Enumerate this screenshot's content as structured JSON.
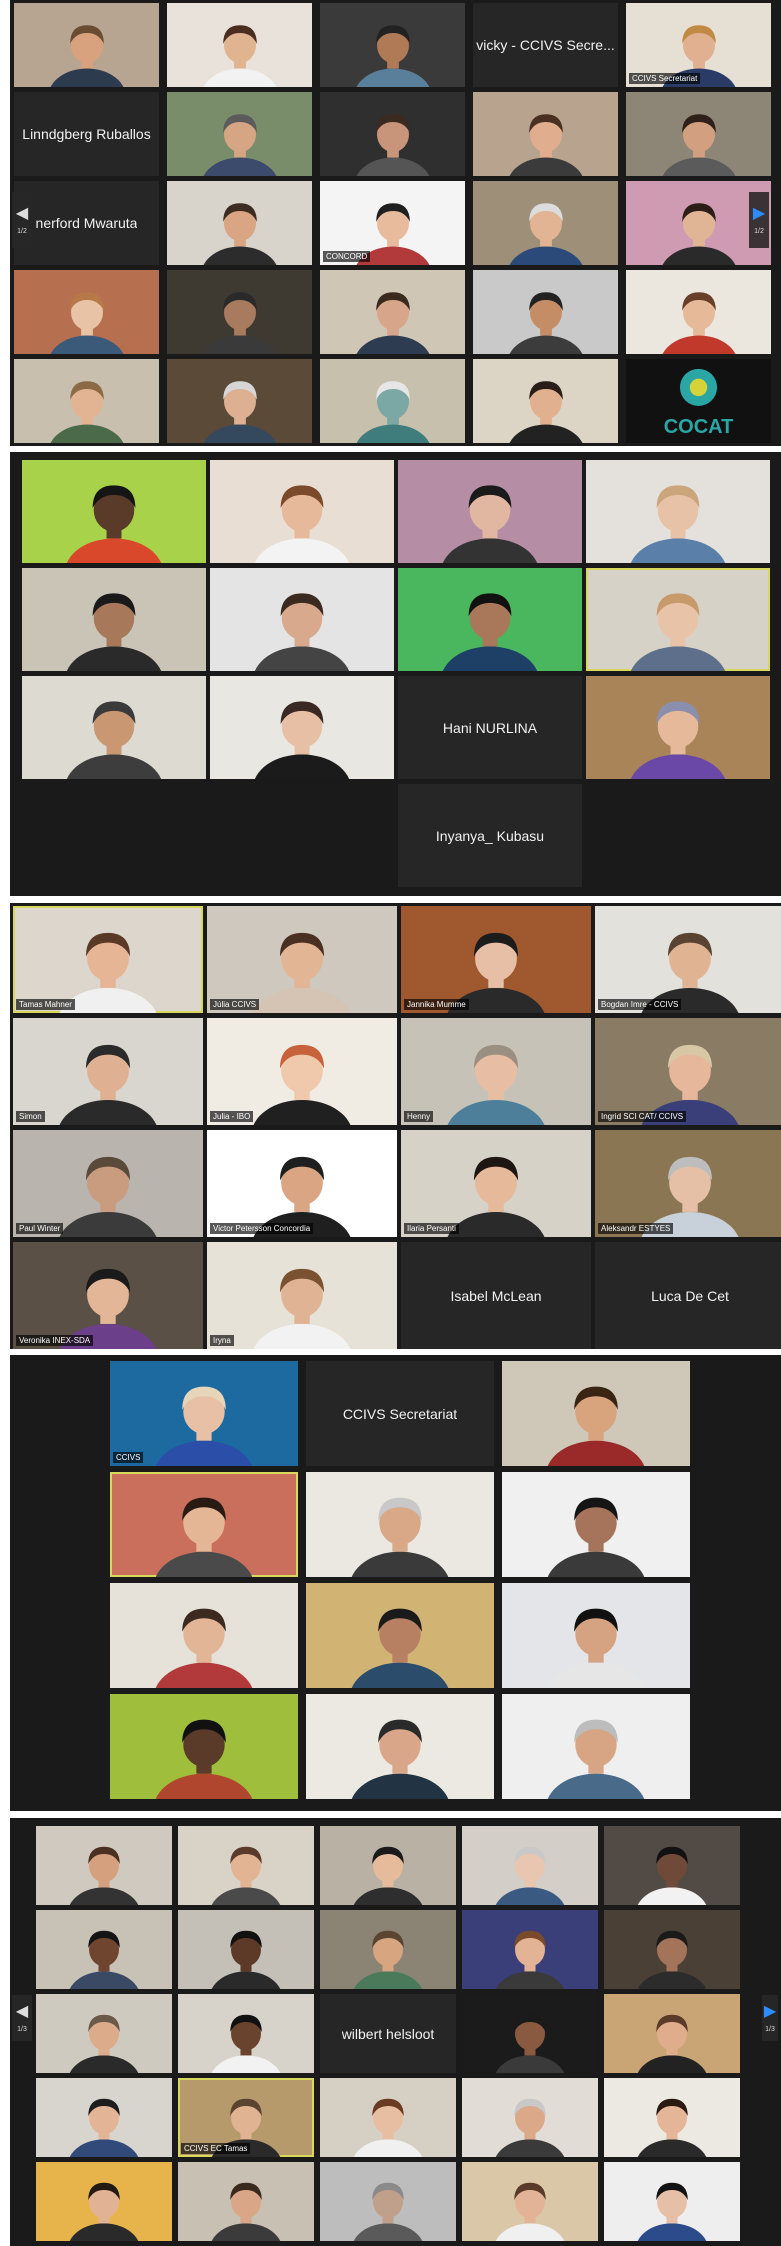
{
  "screenshot_1": {
    "tiles": [
      {
        "kind": "video",
        "bg": "#b7a592",
        "skin": "#d9a27e",
        "hair": "#6a4c33",
        "shirt": "#2d3b4e",
        "caption": ""
      },
      {
        "kind": "video",
        "bg": "#e8e2da",
        "skin": "#e0b48f",
        "hair": "#4b2e20",
        "shirt": "#f2f2f2",
        "caption": ""
      },
      {
        "kind": "video",
        "bg": "#3a3a3a",
        "skin": "#b07a57",
        "hair": "#222222",
        "shirt": "#5a7f9b",
        "caption": ""
      },
      {
        "kind": "name",
        "name": "vicky - CCIVS Secre..."
      },
      {
        "kind": "video",
        "bg": "#e6dfd3",
        "skin": "#e1b090",
        "hair": "#c08a45",
        "shirt": "#2a3c66",
        "caption": "CCIVS Secretariat"
      },
      {
        "kind": "name",
        "name": "Linndgberg Ruballos"
      },
      {
        "kind": "video",
        "bg": "#7a8d6b",
        "skin": "#d6a583",
        "hair": "#5b5b5b",
        "shirt": "#3c4a6b",
        "caption": ""
      },
      {
        "kind": "video",
        "bg": "#2f2f2f",
        "skin": "#c8957a",
        "hair": "#3a2a20",
        "shirt": "#555555",
        "caption": ""
      },
      {
        "kind": "video",
        "bg": "#b8a48e",
        "skin": "#e0ae8e",
        "hair": "#4a3020",
        "shirt": "#3b3b3b",
        "caption": ""
      },
      {
        "kind": "video",
        "bg": "#8d8575",
        "skin": "#d2a080",
        "hair": "#2f2119",
        "shirt": "#5b5b5b",
        "caption": ""
      },
      {
        "kind": "name",
        "name": "nerford Mwaruta"
      },
      {
        "kind": "video",
        "bg": "#d8d4cc",
        "skin": "#d9a583",
        "hair": "#3d2c22",
        "shirt": "#2c2c2c",
        "caption": ""
      },
      {
        "kind": "video",
        "bg": "#f4f4f4",
        "skin": "#e7bb9c",
        "hair": "#1f1f1f",
        "shirt": "#b23a3a",
        "caption": "CONCORD"
      },
      {
        "kind": "video",
        "bg": "#9d8f78",
        "skin": "#e2b493",
        "hair": "#dcdcdc",
        "shirt": "#2b4a7a",
        "caption": ""
      },
      {
        "kind": "video",
        "bg": "#cf9bb3",
        "skin": "#e0b596",
        "hair": "#2b1e18",
        "shirt": "#2a2a2a",
        "caption": ""
      },
      {
        "kind": "video",
        "bg": "#b6704f",
        "skin": "#e9c3a6",
        "hair": "#b57a48",
        "shirt": "#3b5a7a",
        "caption": ""
      },
      {
        "kind": "video",
        "bg": "#3e3a32",
        "skin": "#a87a5e",
        "hair": "#2a2a2a",
        "shirt": "#3a3a3a",
        "caption": ""
      },
      {
        "kind": "video",
        "bg": "#cfc6b6",
        "skin": "#d7a58a",
        "hair": "#3a2a1e",
        "shirt": "#2e3c52",
        "caption": ""
      },
      {
        "kind": "video",
        "bg": "#c9c9c9",
        "skin": "#c58d66",
        "hair": "#222222",
        "shirt": "#3c3c3c",
        "caption": ""
      },
      {
        "kind": "video",
        "bg": "#ebe7de",
        "skin": "#e6b998",
        "hair": "#6a3f2a",
        "shirt": "#c0392b",
        "caption": ""
      },
      {
        "kind": "video",
        "bg": "#c9bfae",
        "skin": "#e2b494",
        "hair": "#8b6a45",
        "shirt": "#4a6a4a",
        "caption": ""
      },
      {
        "kind": "video",
        "bg": "#5b4a38",
        "skin": "#dcb091",
        "hair": "#d6d6d6",
        "shirt": "#34495e",
        "caption": ""
      },
      {
        "kind": "video",
        "bg": "#c7c0ad",
        "skin": "#7ba7a4",
        "hair": "#e6e6e6",
        "shirt": "#3f7c7c",
        "caption": ""
      },
      {
        "kind": "video",
        "bg": "#dcd5c6",
        "skin": "#e0b08f",
        "hair": "#2a1c16",
        "shirt": "#222222",
        "caption": ""
      },
      {
        "kind": "logo",
        "logo_text": "COCAT",
        "bg": "#111111"
      }
    ],
    "pager": {
      "left_page": "1/2",
      "right_page": "1/2"
    }
  },
  "screenshot_2": {
    "tiles": [
      {
        "kind": "video",
        "bg": "#a8d24a",
        "skin": "#5a3a28",
        "hair": "#151515",
        "shirt": "#d9482b",
        "caption": ""
      },
      {
        "kind": "video",
        "bg": "#e8ded4",
        "skin": "#e6b99a",
        "hair": "#7b4a2a",
        "shirt": "#f3f3f3",
        "caption": ""
      },
      {
        "kind": "video",
        "bg": "#b58ea6",
        "skin": "#e2b7a2",
        "hair": "#1a1a1a",
        "shirt": "#333333",
        "caption": ""
      },
      {
        "kind": "video",
        "bg": "#e4e1dc",
        "skin": "#e7c2a6",
        "hair": "#caa67a",
        "shirt": "#5a7fa8",
        "caption": ""
      },
      {
        "kind": "video",
        "bg": "#c9c4b6",
        "skin": "#a8785b",
        "hair": "#1a1a1a",
        "shirt": "#2a2a2a",
        "caption": ""
      },
      {
        "kind": "video",
        "bg": "#e4e4e4",
        "skin": "#d8a98c",
        "hair": "#3b2a20",
        "shirt": "#444444",
        "caption": ""
      },
      {
        "kind": "video",
        "bg": "#4ab65d",
        "skin": "#a9785b",
        "hair": "#111111",
        "shirt": "#1e3f66",
        "caption": ""
      },
      {
        "kind": "video",
        "bg": "#d7d2c8",
        "skin": "#e8c3a8",
        "hair": "#c69a6a",
        "shirt": "#5d6f8a",
        "caption": ""
      },
      {
        "kind": "video",
        "bg": "#dddad2",
        "skin": "#c99772",
        "hair": "#3a3a3a",
        "shirt": "#3d3d3d",
        "caption": ""
      },
      {
        "kind": "video",
        "bg": "#e9e7e2",
        "skin": "#e7bfa4",
        "hair": "#3a2822",
        "shirt": "#1b1b1b",
        "caption": ""
      },
      {
        "kind": "name",
        "name": "Hani NURLINA"
      },
      {
        "kind": "video",
        "bg": "#a98459",
        "skin": "#e6b99b",
        "hair": "#8a8fae",
        "shirt": "#6a48a8",
        "caption": ""
      },
      {
        "kind": "empty"
      },
      {
        "kind": "empty"
      },
      {
        "kind": "name",
        "name": "Inyanya_ Kubasu"
      },
      {
        "kind": "empty"
      }
    ]
  },
  "screenshot_3": {
    "tiles": [
      {
        "kind": "video",
        "bg": "#dcd6cc",
        "skin": "#e6b596",
        "hair": "#5a3a26",
        "shirt": "#f0f0f0",
        "caption": "Tamas Mahner"
      },
      {
        "kind": "video",
        "bg": "#cfc8be",
        "skin": "#e2b594",
        "hair": "#4a3022",
        "shirt": "#d5c3b4",
        "caption": "Júlia CCIVS"
      },
      {
        "kind": "video",
        "bg": "#a0582f",
        "skin": "#e6bfa6",
        "hair": "#1c1c1c",
        "shirt": "#2a2a2a",
        "caption": "Jannika Mumme"
      },
      {
        "kind": "video",
        "bg": "#e3e1dc",
        "skin": "#e0b493",
        "hair": "#5a4330",
        "shirt": "#2a2a2a",
        "caption": "Bogdan Imre - CCIVS"
      },
      {
        "kind": "video",
        "bg": "#d9d6cf",
        "skin": "#dfb091",
        "hair": "#2a2a2a",
        "shirt": "#2a2a2a",
        "caption": "Simon"
      },
      {
        "kind": "video",
        "bg": "#f0ece4",
        "skin": "#f0c8ac",
        "hair": "#c7623a",
        "shirt": "#202020",
        "caption": "Julia - IBO"
      },
      {
        "kind": "video",
        "bg": "#c6c2b8",
        "skin": "#e7bea3",
        "hair": "#9a8f80",
        "shirt": "#4d7f9a",
        "caption": "Henny"
      },
      {
        "kind": "video",
        "bg": "#8a7c64",
        "skin": "#e6b79a",
        "hair": "#d8c7a4",
        "shirt": "#3a3f7a",
        "caption": "Ingrid SCI CAT/ CCIVS"
      },
      {
        "kind": "video",
        "bg": "#b9b4ad",
        "skin": "#c99b7f",
        "hair": "#5a4a3a",
        "shirt": "#3b3b3b",
        "caption": "Paul Winter"
      },
      {
        "kind": "video",
        "bg": "#ffffff",
        "skin": "#d9a583",
        "hair": "#1f1f1f",
        "shirt": "#1f1f1f",
        "caption": "Victor Petersson Concordia"
      },
      {
        "kind": "video",
        "bg": "#d6d2c8",
        "skin": "#e6b99b",
        "hair": "#1e1612",
        "shirt": "#2a2a2a",
        "caption": "Ilaria Persanti"
      },
      {
        "kind": "video",
        "bg": "#8a7652",
        "skin": "#e5c0a6",
        "hair": "#bdbdbd",
        "shirt": "#c8d0d9",
        "caption": "Aleksandr ESTYES"
      },
      {
        "kind": "video",
        "bg": "#5b5045",
        "skin": "#e3b698",
        "hair": "#1a1a1a",
        "shirt": "#6b3f8a",
        "caption": "Veronika INEX-SDA"
      },
      {
        "kind": "video",
        "bg": "#e7e2d8",
        "skin": "#e1b395",
        "hair": "#7a5232",
        "shirt": "#f2f2f2",
        "caption": "Iryna"
      },
      {
        "kind": "name",
        "name": "Isabel McLean"
      },
      {
        "kind": "name",
        "name": "Luca De Cet"
      }
    ]
  },
  "screenshot_4": {
    "tiles": [
      {
        "kind": "video",
        "bg": "#1d6aa0",
        "skin": "#e7c0a6",
        "hair": "#e6d5b8",
        "shirt": "#2b4fa8",
        "caption": "CCIVS"
      },
      {
        "kind": "name",
        "name": "CCIVS Secretariat"
      },
      {
        "kind": "video",
        "bg": "#cfc7b8",
        "skin": "#d7a47e",
        "hair": "#3a2414",
        "shirt": "#9a2a2a",
        "caption": ""
      },
      {
        "kind": "video",
        "bg": "#c96f5c",
        "skin": "#e4b696",
        "hair": "#2a1a14",
        "shirt": "#4a4a4a",
        "caption": ""
      },
      {
        "kind": "video",
        "bg": "#ebe8e2",
        "skin": "#d9a886",
        "hair": "#c8c8c8",
        "shirt": "#3a3a3a",
        "caption": ""
      },
      {
        "kind": "video",
        "bg": "#f0f0f0",
        "skin": "#a6745a",
        "hair": "#151515",
        "shirt": "#3a3a3a",
        "caption": ""
      },
      {
        "kind": "video",
        "bg": "#e7e2d9",
        "skin": "#e2b597",
        "hair": "#3c2a20",
        "shirt": "#b23a3a",
        "caption": ""
      },
      {
        "kind": "video",
        "bg": "#d1b373",
        "skin": "#b88062",
        "hair": "#1a1a1a",
        "shirt": "#2c4c6c",
        "caption": ""
      },
      {
        "kind": "video",
        "bg": "#e3e5e8",
        "skin": "#d5a382",
        "hair": "#111111",
        "shirt": "#e6e6e6",
        "caption": ""
      },
      {
        "kind": "video",
        "bg": "#9fbe3b",
        "skin": "#5a3a28",
        "hair": "#111111",
        "shirt": "#b0462d",
        "caption": ""
      },
      {
        "kind": "video",
        "bg": "#ece9e3",
        "skin": "#d9a68a",
        "hair": "#2a2a2a",
        "shirt": "#223344",
        "caption": ""
      },
      {
        "kind": "video",
        "bg": "#efefef",
        "skin": "#d8a584",
        "hair": "#bdbdbd",
        "shirt": "#4a6a8a",
        "caption": ""
      }
    ]
  },
  "screenshot_5": {
    "tiles": [
      {
        "kind": "video",
        "bg": "#cfc9bf",
        "skin": "#d5a07e",
        "hair": "#4a3020",
        "shirt": "#333333",
        "caption": ""
      },
      {
        "kind": "video",
        "bg": "#d9d2c6",
        "skin": "#e2b494",
        "hair": "#5a3a2a",
        "shirt": "#4a4a4a",
        "caption": ""
      },
      {
        "kind": "video",
        "bg": "#b9b1a4",
        "skin": "#e6bb9b",
        "hair": "#1a1a1a",
        "shirt": "#2e2e2e",
        "caption": ""
      },
      {
        "kind": "video",
        "bg": "#d3cfc8",
        "skin": "#e8c6b0",
        "hair": "#c9c9c9",
        "shirt": "#3b5a82",
        "caption": ""
      },
      {
        "kind": "video",
        "bg": "#524a44",
        "skin": "#6f4a38",
        "hair": "#121212",
        "shirt": "#f2f2f2",
        "caption": ""
      },
      {
        "kind": "video",
        "bg": "#c8c1b5",
        "skin": "#70452f",
        "hair": "#141414",
        "shirt": "#3a4a64",
        "caption": ""
      },
      {
        "kind": "video",
        "bg": "#c4c0b8",
        "skin": "#5d3a28",
        "hair": "#111111",
        "shirt": "#2a2a2a",
        "caption": ""
      },
      {
        "kind": "video",
        "bg": "#8b8475",
        "skin": "#d7a580",
        "hair": "#5a4432",
        "shirt": "#4a7a5a",
        "caption": ""
      },
      {
        "kind": "video",
        "bg": "#3a3f7a",
        "skin": "#e2b394",
        "hair": "#7a4a2a",
        "shirt": "#3a3a3a",
        "caption": ""
      },
      {
        "kind": "video",
        "bg": "#4a4035",
        "skin": "#a3735a",
        "hair": "#1a1a1a",
        "shirt": "#2c2c2c",
        "caption": ""
      },
      {
        "kind": "video",
        "bg": "#cfcac0",
        "skin": "#dcab89",
        "hair": "#6a5a4a",
        "shirt": "#2a2a2a",
        "caption": ""
      },
      {
        "kind": "video",
        "bg": "#d7d3cb",
        "skin": "#6a432e",
        "hair": "#111111",
        "shirt": "#f2f2f2",
        "caption": ""
      },
      {
        "kind": "name",
        "name": "wilbert helsloot"
      },
      {
        "kind": "video",
        "bg": "#1b1b1b",
        "skin": "#8a5a40",
        "hair": "#1a1a1a",
        "shirt": "#3a3a3a",
        "caption": ""
      },
      {
        "kind": "video",
        "bg": "#c9a474",
        "skin": "#e0ad8c",
        "hair": "#5a3a28",
        "shirt": "#222222",
        "caption": ""
      },
      {
        "kind": "video",
        "bg": "#d8d5cf",
        "skin": "#e3b596",
        "hair": "#1e1e1e",
        "shirt": "#314a7a",
        "caption": ""
      },
      {
        "kind": "video",
        "bg": "#b79a6c",
        "skin": "#e0b392",
        "hair": "#5a4330",
        "shirt": "#2a2a2a",
        "caption": "CCIVS EC Tamas"
      },
      {
        "kind": "video",
        "bg": "#d6cfc3",
        "skin": "#e7bea1",
        "hair": "#6a3a22",
        "shirt": "#f0f0f0",
        "caption": ""
      },
      {
        "kind": "video",
        "bg": "#e1ddd6",
        "skin": "#dba98a",
        "hair": "#c8c8c8",
        "shirt": "#3a3a3a",
        "caption": ""
      },
      {
        "kind": "video",
        "bg": "#ece8e2",
        "skin": "#e4b596",
        "hair": "#2a1a12",
        "shirt": "#2a2a2a",
        "caption": ""
      },
      {
        "kind": "video",
        "bg": "#e6b44a",
        "skin": "#e1b394",
        "hair": "#241a14",
        "shirt": "#2a2a2a",
        "caption": ""
      },
      {
        "kind": "video",
        "bg": "#c8c0b2",
        "skin": "#d9a787",
        "hair": "#3a2a1e",
        "shirt": "#3b3b3b",
        "caption": ""
      },
      {
        "kind": "video",
        "bg": "#bdbdbd",
        "skin": "#c0a08a",
        "hair": "#8a8a8a",
        "shirt": "#5a5a5a",
        "caption": ""
      },
      {
        "kind": "video",
        "bg": "#d9c7a8",
        "skin": "#e2b396",
        "hair": "#5a3a28",
        "shirt": "#f0f0f0",
        "caption": ""
      },
      {
        "kind": "video",
        "bg": "#eeeeee",
        "skin": "#e6c0a6",
        "hair": "#121212",
        "shirt": "#2b4b8a",
        "caption": ""
      }
    ],
    "pager": {
      "left_page": "1/3",
      "right_page": "1/3"
    }
  }
}
